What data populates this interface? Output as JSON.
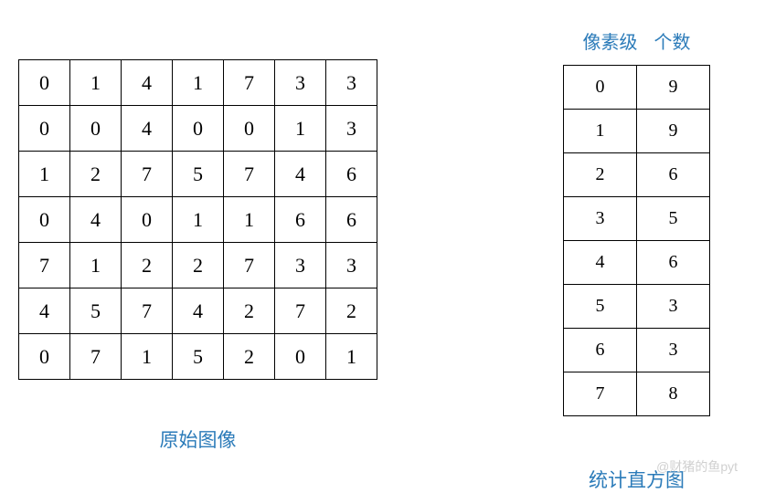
{
  "left": {
    "caption": "原始图像",
    "grid": [
      [
        0,
        1,
        4,
        1,
        7,
        3,
        3
      ],
      [
        0,
        0,
        4,
        0,
        0,
        1,
        3
      ],
      [
        1,
        2,
        7,
        5,
        7,
        4,
        6
      ],
      [
        0,
        4,
        0,
        1,
        1,
        6,
        6
      ],
      [
        7,
        1,
        2,
        2,
        7,
        3,
        3
      ],
      [
        4,
        5,
        7,
        4,
        2,
        7,
        2
      ],
      [
        0,
        7,
        1,
        5,
        2,
        0,
        1
      ]
    ]
  },
  "right": {
    "header_level": "像素级",
    "header_count": "个数",
    "caption": "统计直方图",
    "rows": [
      {
        "level": 0,
        "count": 9
      },
      {
        "level": 1,
        "count": 9
      },
      {
        "level": 2,
        "count": 6
      },
      {
        "level": 3,
        "count": 5
      },
      {
        "level": 4,
        "count": 6
      },
      {
        "level": 5,
        "count": 3
      },
      {
        "level": 6,
        "count": 3
      },
      {
        "level": 7,
        "count": 8
      }
    ]
  },
  "watermark": "@财猪的鱼pyt",
  "chart_data": {
    "type": "table",
    "title": "原始图像 / 统计直方图",
    "pixel_grid": {
      "rows": 7,
      "cols": 7,
      "values": [
        [
          0,
          1,
          4,
          1,
          7,
          3,
          3
        ],
        [
          0,
          0,
          4,
          0,
          0,
          1,
          3
        ],
        [
          1,
          2,
          7,
          5,
          7,
          4,
          6
        ],
        [
          0,
          4,
          0,
          1,
          1,
          6,
          6
        ],
        [
          7,
          1,
          2,
          2,
          7,
          3,
          3
        ],
        [
          4,
          5,
          7,
          4,
          2,
          7,
          2
        ],
        [
          0,
          7,
          1,
          5,
          2,
          0,
          1
        ]
      ]
    },
    "histogram": {
      "xlabel": "像素级",
      "ylabel": "个数",
      "categories": [
        0,
        1,
        2,
        3,
        4,
        5,
        6,
        7
      ],
      "values": [
        9,
        9,
        6,
        5,
        6,
        3,
        3,
        8
      ]
    }
  }
}
